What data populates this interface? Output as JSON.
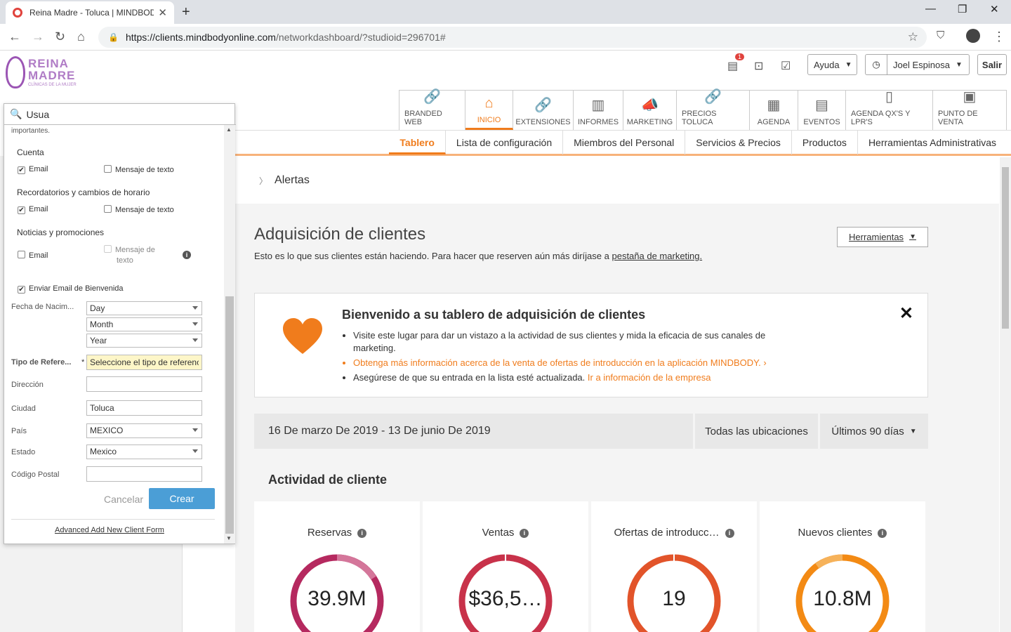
{
  "browser": {
    "tab_title": "Reina Madre - Toluca | MINDBODY",
    "url_host": "https://clients.mindbodyonline.com",
    "url_path": "/networkdashboard/?studioid=296701#"
  },
  "header": {
    "logo_line1": "REINA",
    "logo_line2": "MADRE",
    "logo_tagline": "CLÍNICAS DE LA MUJER",
    "notification_count": "1",
    "help_label": "Ayuda",
    "user_name": "Joel Espinosa",
    "logout_label": "Salir"
  },
  "main_tabs": [
    {
      "label": "BRANDED WEB",
      "icon": "link-icon"
    },
    {
      "label": "INICIO",
      "icon": "home-icon"
    },
    {
      "label": "EXTENSIONES",
      "icon": "link-icon"
    },
    {
      "label": "INFORMES",
      "icon": "chart-icon"
    },
    {
      "label": "MARKETING",
      "icon": "megaphone-icon"
    },
    {
      "label": "PRECIOS TOLUCA",
      "icon": "link-icon"
    },
    {
      "label": "AGENDA",
      "icon": "calendar-icon"
    },
    {
      "label": "EVENTOS",
      "icon": "calendar-icon"
    },
    {
      "label": "AGENDA QX'S Y LPR'S",
      "icon": "phone-icon"
    },
    {
      "label": "PUNTO DE VENTA",
      "icon": "register-icon"
    }
  ],
  "sub_tabs": [
    "Tablero",
    "Lista de configuración",
    "Miembros del Personal",
    "Servicios & Precios",
    "Productos",
    "Herramientas Administrativas"
  ],
  "alerts_label": "Alertas",
  "acquisition": {
    "title": "Adquisición de clientes",
    "subtitle": "Esto es lo que sus clientes están haciendo. Para hacer que reserven aún más diríjase a",
    "subtitle_link": "pestaña de marketing.",
    "tools_label": "Herramientas"
  },
  "welcome": {
    "title": "Bienvenido a su tablero de adquisición de clientes",
    "bullet1": "Visite este lugar para dar un vistazo a la actividad de sus clientes y mida la eficacia de sus canales de marketing.",
    "bullet2": "Obtenga más información acerca de la venta de ofertas de introducción en la aplicación MINDBODY.",
    "bullet3": "Asegúrese de que su entrada en la lista esté actualizada.",
    "bullet3_link": "Ir a información de la empresa"
  },
  "filters": {
    "date_range": "16 De marzo De 2019 - 13 De junio De 2019",
    "locations": "Todas las ubicaciones",
    "period": "Últimos 90 días"
  },
  "activity": {
    "title": "Actividad de cliente",
    "cards": [
      {
        "label": "Reservas",
        "value": "39.9M",
        "color": "#b5295f",
        "secondary": "#d4769a"
      },
      {
        "label": "Ventas",
        "value": "$36,5…",
        "color": "#c8324a",
        "secondary": "#c8324a"
      },
      {
        "label": "Ofertas de introducc…",
        "value": "19",
        "color": "#e2542a",
        "secondary": "#e2542a"
      },
      {
        "label": "Nuevos clientes",
        "value": "10.8M",
        "color": "#f38a14",
        "secondary": "#f6b25a"
      }
    ]
  },
  "popup": {
    "search_value": "Usua",
    "top_text": "importantes.",
    "section_account": "Cuenta",
    "section_reminders": "Recordatorios y cambios de horario",
    "section_news": "Noticias y promociones",
    "email_label": "Email",
    "sms_label": "Mensaje de texto",
    "sms_label_line1": "Mensaje de",
    "sms_label_line2": "texto",
    "welcome_email": "Enviar Email de Bienvenida",
    "birth_label": "Fecha de Nacim...",
    "day": "Day",
    "month": "Month",
    "year": "Year",
    "referral_label": "Tipo de Refere...",
    "referral_value": "Seleccione el tipo de referencia",
    "address_label": "Dirección",
    "city_label": "Ciudad",
    "city_value": "Toluca",
    "country_label": "País",
    "country_value": "MEXICO",
    "state_label": "Estado",
    "state_value": "Mexico",
    "zip_label": "Código Postal",
    "cancel": "Cancelar",
    "create": "Crear",
    "advanced_link": "Advanced Add New Client Form"
  }
}
